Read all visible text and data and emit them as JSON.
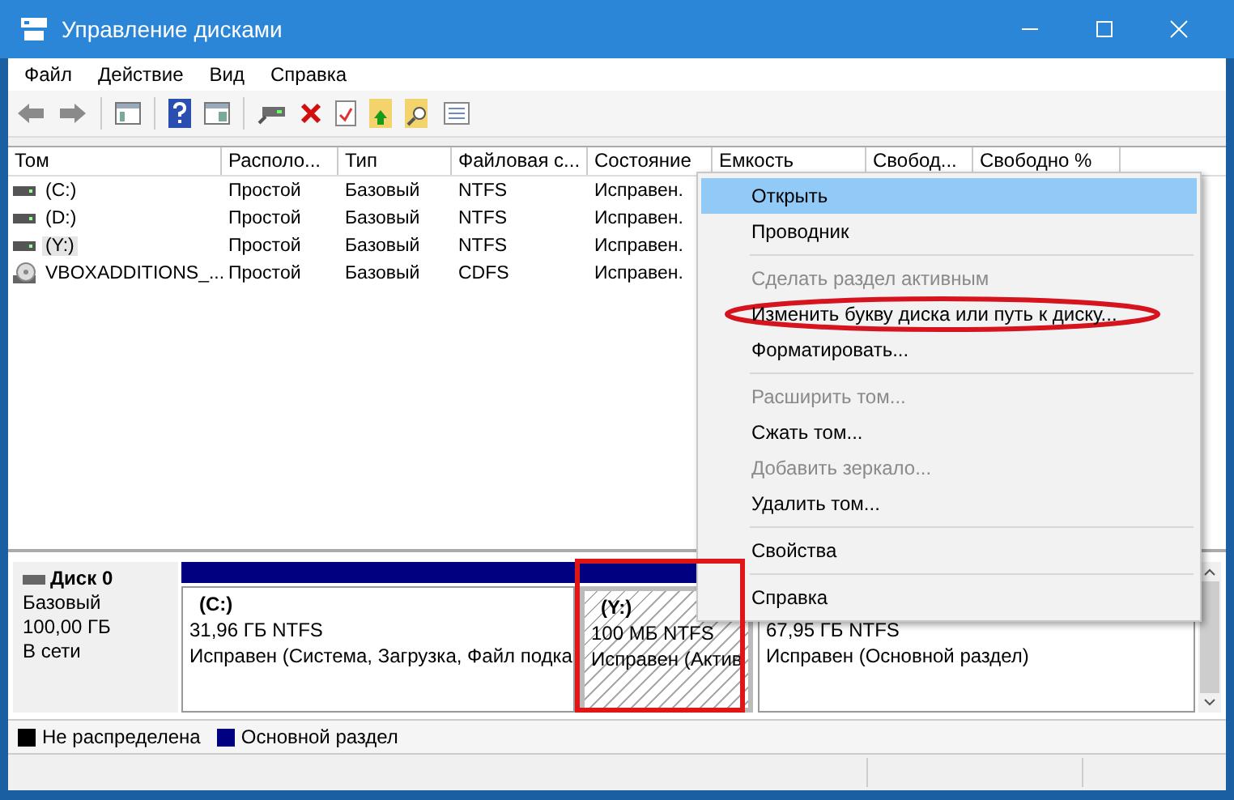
{
  "window": {
    "title": "Управление дисками"
  },
  "menu_bar": [
    "Файл",
    "Действие",
    "Вид",
    "Справка"
  ],
  "table": {
    "columns": [
      "Том",
      "Располо...",
      "Тип",
      "Файловая с...",
      "Состояние",
      "Емкость",
      "Свобод...",
      "Свободно %"
    ],
    "rows": [
      {
        "kind": "disk",
        "selected": false,
        "cells": [
          "(C:)",
          "Простой",
          "Базовый",
          "NTFS",
          "Исправен."
        ]
      },
      {
        "kind": "disk",
        "selected": false,
        "cells": [
          "(D:)",
          "Простой",
          "Базовый",
          "NTFS",
          "Исправен."
        ]
      },
      {
        "kind": "disk",
        "selected": true,
        "cells": [
          "(Y:)",
          "Простой",
          "Базовый",
          "NTFS",
          "Исправен."
        ]
      },
      {
        "kind": "cdrom",
        "selected": false,
        "cells": [
          "VBOXADDITIONS_...",
          "Простой",
          "Базовый",
          "CDFS",
          "Исправен."
        ]
      }
    ]
  },
  "disk": {
    "name": "Диск 0",
    "type": "Базовый",
    "size": "100,00 ГБ",
    "state": "В сети",
    "partitions": [
      {
        "label": "(C:)",
        "size": "31,96 ГБ NTFS",
        "status": "Исправен (Система, Загрузка, Файл подка",
        "selected": false
      },
      {
        "label": "(Y:)",
        "size": "100 МБ NTFS",
        "status": "Исправен (Актив",
        "selected": true
      },
      {
        "size": "67,95 ГБ NTFS",
        "status": "Исправен (Основной раздел)",
        "selected": false
      }
    ]
  },
  "legend": [
    {
      "label": "Не распределена",
      "color": "#000000"
    },
    {
      "label": "Основной раздел",
      "color": "#000080"
    }
  ],
  "context_menu": [
    {
      "kind": "item",
      "label": "Открыть",
      "selected": true,
      "disabled": false,
      "circled": false
    },
    {
      "kind": "item",
      "label": "Проводник",
      "selected": false,
      "disabled": false,
      "circled": false
    },
    {
      "kind": "separator"
    },
    {
      "kind": "item",
      "label": "Сделать раздел активным",
      "selected": false,
      "disabled": true
    },
    {
      "kind": "item",
      "label": "Изменить букву диска или путь к диску...",
      "selected": false,
      "disabled": false,
      "circled": true
    },
    {
      "kind": "item",
      "label": "Форматировать...",
      "selected": false,
      "disabled": false
    },
    {
      "kind": "separator"
    },
    {
      "kind": "item",
      "label": "Расширить том...",
      "selected": false,
      "disabled": true
    },
    {
      "kind": "item",
      "label": "Сжать том...",
      "selected": false,
      "disabled": false
    },
    {
      "kind": "item",
      "label": "Добавить зеркало...",
      "selected": false,
      "disabled": true
    },
    {
      "kind": "item",
      "label": "Удалить том...",
      "selected": false,
      "disabled": false
    },
    {
      "kind": "separator"
    },
    {
      "kind": "item",
      "label": "Свойства",
      "selected": false,
      "disabled": false
    },
    {
      "kind": "separator"
    },
    {
      "kind": "item",
      "label": "Справка",
      "selected": false,
      "disabled": false
    }
  ]
}
